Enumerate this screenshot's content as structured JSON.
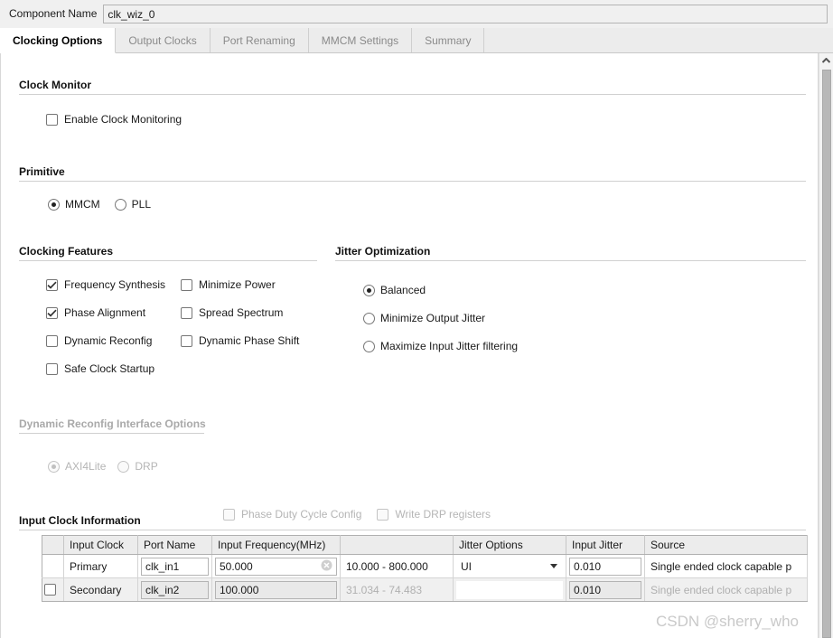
{
  "header": {
    "component_name_label": "Component Name",
    "component_name_value": "clk_wiz_0"
  },
  "tabs": [
    {
      "label": "Clocking Options",
      "active": true
    },
    {
      "label": "Output Clocks",
      "active": false
    },
    {
      "label": "Port Renaming",
      "active": false
    },
    {
      "label": "MMCM Settings",
      "active": false
    },
    {
      "label": "Summary",
      "active": false
    }
  ],
  "clock_monitor": {
    "title": "Clock Monitor",
    "enable_label": "Enable Clock Monitoring",
    "enable_checked": false
  },
  "primitive": {
    "title": "Primitive",
    "options": [
      {
        "label": "MMCM",
        "selected": true
      },
      {
        "label": "PLL",
        "selected": false
      }
    ]
  },
  "clocking_features": {
    "title": "Clocking Features",
    "col1": [
      {
        "label": "Frequency Synthesis",
        "checked": true
      },
      {
        "label": "Phase Alignment",
        "checked": true
      },
      {
        "label": "Dynamic Reconfig",
        "checked": false
      },
      {
        "label": "Safe Clock Startup",
        "checked": false
      }
    ],
    "col2": [
      {
        "label": "Minimize Power",
        "checked": false
      },
      {
        "label": "Spread Spectrum",
        "checked": false
      },
      {
        "label": "Dynamic Phase Shift",
        "checked": false
      }
    ]
  },
  "jitter_optimization": {
    "title": "Jitter Optimization",
    "options": [
      {
        "label": "Balanced",
        "selected": true
      },
      {
        "label": "Minimize Output Jitter",
        "selected": false
      },
      {
        "label": "Maximize Input Jitter filtering",
        "selected": false
      }
    ]
  },
  "dynamic_reconfig": {
    "title": "Dynamic Reconfig Interface Options",
    "disabled": true,
    "radios": [
      {
        "label": "AXI4Lite",
        "selected": true
      },
      {
        "label": "DRP",
        "selected": false
      }
    ],
    "checkboxes": [
      {
        "label": "Phase Duty Cycle Config",
        "checked": false
      },
      {
        "label": "Write DRP registers",
        "checked": false
      }
    ]
  },
  "input_clock_information": {
    "title": "Input Clock Information",
    "columns": [
      "",
      "Input Clock",
      "Port Name",
      "Input Frequency(MHz)",
      "",
      "Jitter Options",
      "Input Jitter",
      "Source"
    ],
    "rows": [
      {
        "select_checkbox": null,
        "input_clock": "Primary",
        "port_name": "clk_in1",
        "input_frequency": "50.000",
        "frequency_range": "10.000 - 800.000",
        "jitter_options": "UI",
        "input_jitter": "0.010",
        "source": "Single ended clock capable p",
        "enabled": true
      },
      {
        "select_checkbox": false,
        "input_clock": "Secondary",
        "port_name": "clk_in2",
        "input_frequency": "100.000",
        "frequency_range": "31.034 - 74.483",
        "jitter_options": "",
        "input_jitter": "0.010",
        "source": "Single ended clock capable p",
        "enabled": false
      }
    ]
  },
  "watermark": "CSDN @sherry_who",
  "icons": {
    "clear": "clear-icon",
    "scroll_up": "scroll-up-arrow-icon",
    "dropdown": "chevron-down-icon",
    "check": "check-icon"
  },
  "colors": {
    "panel": "#f0f0f0",
    "tab_active_bg": "#ffffff",
    "tab_inactive_text": "#8a8a8a",
    "rule": "#d0d0d0",
    "disabled_text": "#b5b5b5",
    "watermark": "#c9c9c9"
  }
}
